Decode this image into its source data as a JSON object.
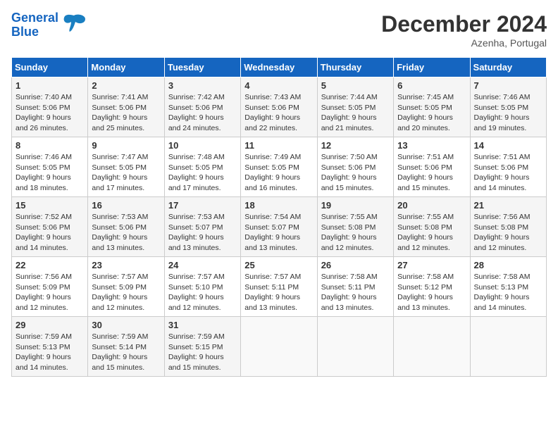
{
  "header": {
    "logo_line1": "General",
    "logo_line2": "Blue",
    "month": "December 2024",
    "location": "Azenha, Portugal"
  },
  "weekdays": [
    "Sunday",
    "Monday",
    "Tuesday",
    "Wednesday",
    "Thursday",
    "Friday",
    "Saturday"
  ],
  "weeks": [
    [
      {
        "day": "1",
        "lines": [
          "Sunrise: 7:40 AM",
          "Sunset: 5:06 PM",
          "Daylight: 9 hours",
          "and 26 minutes."
        ]
      },
      {
        "day": "2",
        "lines": [
          "Sunrise: 7:41 AM",
          "Sunset: 5:06 PM",
          "Daylight: 9 hours",
          "and 25 minutes."
        ]
      },
      {
        "day": "3",
        "lines": [
          "Sunrise: 7:42 AM",
          "Sunset: 5:06 PM",
          "Daylight: 9 hours",
          "and 24 minutes."
        ]
      },
      {
        "day": "4",
        "lines": [
          "Sunrise: 7:43 AM",
          "Sunset: 5:06 PM",
          "Daylight: 9 hours",
          "and 22 minutes."
        ]
      },
      {
        "day": "5",
        "lines": [
          "Sunrise: 7:44 AM",
          "Sunset: 5:05 PM",
          "Daylight: 9 hours",
          "and 21 minutes."
        ]
      },
      {
        "day": "6",
        "lines": [
          "Sunrise: 7:45 AM",
          "Sunset: 5:05 PM",
          "Daylight: 9 hours",
          "and 20 minutes."
        ]
      },
      {
        "day": "7",
        "lines": [
          "Sunrise: 7:46 AM",
          "Sunset: 5:05 PM",
          "Daylight: 9 hours",
          "and 19 minutes."
        ]
      }
    ],
    [
      {
        "day": "8",
        "lines": [
          "Sunrise: 7:46 AM",
          "Sunset: 5:05 PM",
          "Daylight: 9 hours",
          "and 18 minutes."
        ]
      },
      {
        "day": "9",
        "lines": [
          "Sunrise: 7:47 AM",
          "Sunset: 5:05 PM",
          "Daylight: 9 hours",
          "and 17 minutes."
        ]
      },
      {
        "day": "10",
        "lines": [
          "Sunrise: 7:48 AM",
          "Sunset: 5:05 PM",
          "Daylight: 9 hours",
          "and 17 minutes."
        ]
      },
      {
        "day": "11",
        "lines": [
          "Sunrise: 7:49 AM",
          "Sunset: 5:05 PM",
          "Daylight: 9 hours",
          "and 16 minutes."
        ]
      },
      {
        "day": "12",
        "lines": [
          "Sunrise: 7:50 AM",
          "Sunset: 5:06 PM",
          "Daylight: 9 hours",
          "and 15 minutes."
        ]
      },
      {
        "day": "13",
        "lines": [
          "Sunrise: 7:51 AM",
          "Sunset: 5:06 PM",
          "Daylight: 9 hours",
          "and 15 minutes."
        ]
      },
      {
        "day": "14",
        "lines": [
          "Sunrise: 7:51 AM",
          "Sunset: 5:06 PM",
          "Daylight: 9 hours",
          "and 14 minutes."
        ]
      }
    ],
    [
      {
        "day": "15",
        "lines": [
          "Sunrise: 7:52 AM",
          "Sunset: 5:06 PM",
          "Daylight: 9 hours",
          "and 14 minutes."
        ]
      },
      {
        "day": "16",
        "lines": [
          "Sunrise: 7:53 AM",
          "Sunset: 5:06 PM",
          "Daylight: 9 hours",
          "and 13 minutes."
        ]
      },
      {
        "day": "17",
        "lines": [
          "Sunrise: 7:53 AM",
          "Sunset: 5:07 PM",
          "Daylight: 9 hours",
          "and 13 minutes."
        ]
      },
      {
        "day": "18",
        "lines": [
          "Sunrise: 7:54 AM",
          "Sunset: 5:07 PM",
          "Daylight: 9 hours",
          "and 13 minutes."
        ]
      },
      {
        "day": "19",
        "lines": [
          "Sunrise: 7:55 AM",
          "Sunset: 5:08 PM",
          "Daylight: 9 hours",
          "and 12 minutes."
        ]
      },
      {
        "day": "20",
        "lines": [
          "Sunrise: 7:55 AM",
          "Sunset: 5:08 PM",
          "Daylight: 9 hours",
          "and 12 minutes."
        ]
      },
      {
        "day": "21",
        "lines": [
          "Sunrise: 7:56 AM",
          "Sunset: 5:08 PM",
          "Daylight: 9 hours",
          "and 12 minutes."
        ]
      }
    ],
    [
      {
        "day": "22",
        "lines": [
          "Sunrise: 7:56 AM",
          "Sunset: 5:09 PM",
          "Daylight: 9 hours",
          "and 12 minutes."
        ]
      },
      {
        "day": "23",
        "lines": [
          "Sunrise: 7:57 AM",
          "Sunset: 5:09 PM",
          "Daylight: 9 hours",
          "and 12 minutes."
        ]
      },
      {
        "day": "24",
        "lines": [
          "Sunrise: 7:57 AM",
          "Sunset: 5:10 PM",
          "Daylight: 9 hours",
          "and 12 minutes."
        ]
      },
      {
        "day": "25",
        "lines": [
          "Sunrise: 7:57 AM",
          "Sunset: 5:11 PM",
          "Daylight: 9 hours",
          "and 13 minutes."
        ]
      },
      {
        "day": "26",
        "lines": [
          "Sunrise: 7:58 AM",
          "Sunset: 5:11 PM",
          "Daylight: 9 hours",
          "and 13 minutes."
        ]
      },
      {
        "day": "27",
        "lines": [
          "Sunrise: 7:58 AM",
          "Sunset: 5:12 PM",
          "Daylight: 9 hours",
          "and 13 minutes."
        ]
      },
      {
        "day": "28",
        "lines": [
          "Sunrise: 7:58 AM",
          "Sunset: 5:13 PM",
          "Daylight: 9 hours",
          "and 14 minutes."
        ]
      }
    ],
    [
      {
        "day": "29",
        "lines": [
          "Sunrise: 7:59 AM",
          "Sunset: 5:13 PM",
          "Daylight: 9 hours",
          "and 14 minutes."
        ]
      },
      {
        "day": "30",
        "lines": [
          "Sunrise: 7:59 AM",
          "Sunset: 5:14 PM",
          "Daylight: 9 hours",
          "and 15 minutes."
        ]
      },
      {
        "day": "31",
        "lines": [
          "Sunrise: 7:59 AM",
          "Sunset: 5:15 PM",
          "Daylight: 9 hours",
          "and 15 minutes."
        ]
      },
      null,
      null,
      null,
      null
    ]
  ]
}
